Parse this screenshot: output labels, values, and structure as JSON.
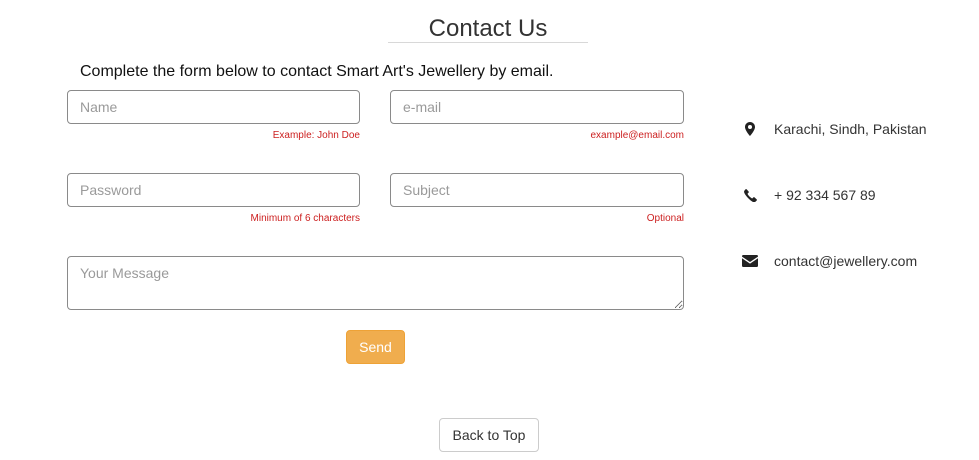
{
  "header": {
    "title": "Contact Us"
  },
  "intro": "Complete the form below to contact Smart Art's Jewellery by email.",
  "form": {
    "name": {
      "placeholder": "Name",
      "hint": "Example: John Doe"
    },
    "email": {
      "placeholder": "e-mail",
      "hint": "example@email.com"
    },
    "password": {
      "placeholder": "Password",
      "hint": "Minimum of 6 characters"
    },
    "subject": {
      "placeholder": "Subject",
      "hint": "Optional"
    },
    "message": {
      "placeholder": "Your Message"
    },
    "send_label": "Send"
  },
  "contact": {
    "items": [
      {
        "icon": "map-marker-icon",
        "text": "Karachi, Sindh, Pakistan"
      },
      {
        "icon": "phone-icon",
        "text": "+ 92 334 567 89"
      },
      {
        "icon": "envelope-icon",
        "text": "contact@jewellery.com"
      }
    ]
  },
  "footer": {
    "back_to_top_label": "Back to Top"
  },
  "colors": {
    "accent": "#f0ad4e",
    "hint": "#cc1f1f",
    "border": "#8a8a8a"
  }
}
